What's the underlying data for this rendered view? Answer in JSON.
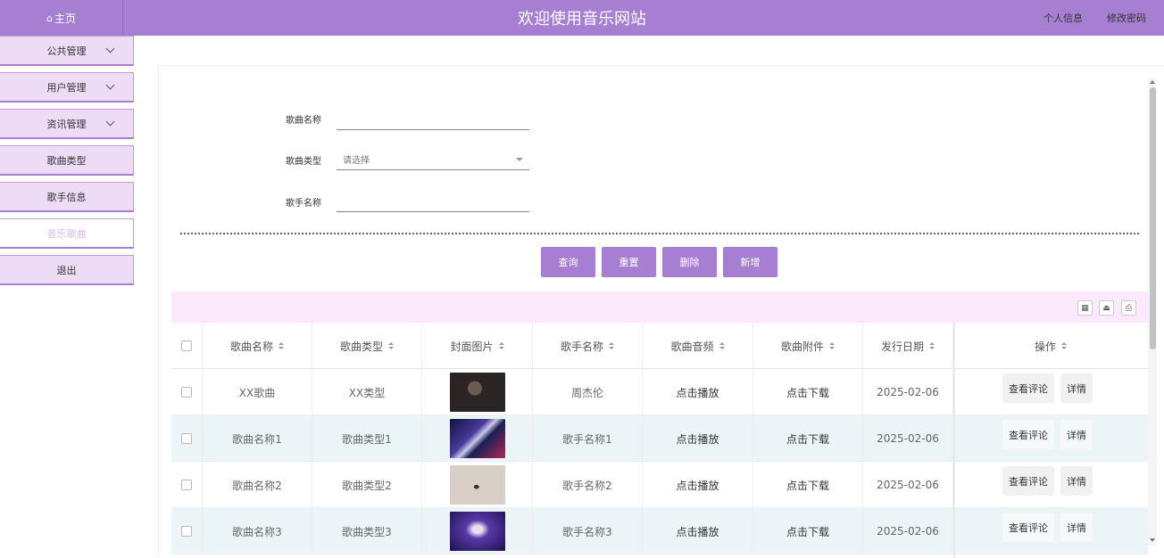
{
  "header": {
    "home_label": "主页",
    "site_title": "欢迎使用音乐网站",
    "profile_link": "个人信息",
    "password_link": "修改密码",
    "background_color": "#a77fd2"
  },
  "sidebar": {
    "items": [
      {
        "label": "公共管理",
        "has_chevron": true
      },
      {
        "label": "用户管理",
        "has_chevron": true
      },
      {
        "label": "资讯管理",
        "has_chevron": true
      },
      {
        "label": "歌曲类型",
        "has_chevron": false
      },
      {
        "label": "歌手信息",
        "has_chevron": false
      },
      {
        "label": "音乐歌曲",
        "has_chevron": false,
        "active": true
      },
      {
        "label": "退出",
        "has_chevron": false
      }
    ]
  },
  "search_form": {
    "song_name_label": "歌曲名称",
    "song_name_value": "",
    "song_type_label": "歌曲类型",
    "song_type_placeholder": "请选择",
    "singer_name_label": "歌手名称",
    "singer_name_value": ""
  },
  "actions": {
    "query": "查询",
    "reset": "重置",
    "delete": "删除",
    "add": "新增",
    "button_color": "#a77fd2"
  },
  "table": {
    "columns": [
      "歌曲名称",
      "歌曲类型",
      "封面图片",
      "歌手名称",
      "歌曲音频",
      "歌曲附件",
      "发行日期",
      "操作"
    ],
    "rows": [
      {
        "song_name": "XX歌曲",
        "song_type": "XX类型",
        "cover": "cover-image-portrait",
        "singer": "周杰伦",
        "audio": "点击播放",
        "attachment": "点击下载",
        "release_date": "2025-02-06",
        "comment_btn": "查看评论",
        "detail_btn": "详情"
      },
      {
        "song_name": "歌曲名称1",
        "song_type": "歌曲类型1",
        "cover": "cover-image-concert",
        "singer": "歌手名称1",
        "audio": "点击播放",
        "attachment": "点击下载",
        "release_date": "2025-02-06",
        "comment_btn": "查看评论",
        "detail_btn": "详情"
      },
      {
        "song_name": "歌曲名称2",
        "song_type": "歌曲类型2",
        "cover": "cover-image-studio",
        "singer": "歌手名称2",
        "audio": "点击播放",
        "attachment": "点击下载",
        "release_date": "2025-02-06",
        "comment_btn": "查看评论",
        "detail_btn": "详情"
      },
      {
        "song_name": "歌曲名称3",
        "song_type": "歌曲类型3",
        "cover": "cover-image-stage",
        "singer": "歌手名称3",
        "audio": "点击播放",
        "attachment": "点击下载",
        "release_date": "2025-02-06",
        "comment_btn": "查看评论",
        "detail_btn": "详情"
      }
    ]
  },
  "toolbar_icons": [
    "columns-icon",
    "export-icon",
    "print-icon"
  ],
  "colors": {
    "accent": "#a77fd2",
    "sidebar_bg": "#eedcf6",
    "toolbar_bg": "#fbe8fb",
    "odd_row_bg": "#ebf4f7"
  }
}
